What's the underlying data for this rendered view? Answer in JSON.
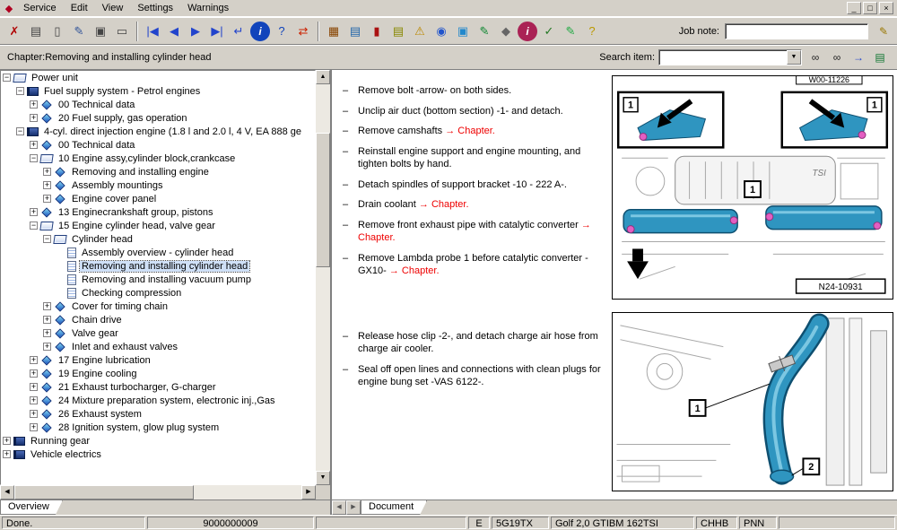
{
  "window": {
    "menu_items": [
      "Service",
      "Edit",
      "View",
      "Settings",
      "Warnings"
    ],
    "controls": {
      "minimize": "_",
      "restore": "□",
      "close": "×"
    }
  },
  "toolbar": {
    "job_note_label": "Job note:",
    "job_note_value": "",
    "icons": [
      {
        "name": "exit-icon",
        "glyph": "✗",
        "color": "#b00000"
      },
      {
        "name": "print-icon",
        "glyph": "▤",
        "color": "#444444"
      },
      {
        "name": "new-document-icon",
        "glyph": "▯",
        "color": "#444444"
      },
      {
        "name": "edit-document-icon",
        "glyph": "✎",
        "color": "#335599"
      },
      {
        "name": "documents-icon",
        "glyph": "▣",
        "color": "#444444"
      },
      {
        "name": "vehicle-data-icon",
        "glyph": "▭",
        "color": "#444444"
      },
      {
        "sep": true
      },
      {
        "name": "first-record-icon",
        "glyph": "|◀",
        "color": "#2244cc"
      },
      {
        "name": "previous-record-icon",
        "glyph": "◀",
        "color": "#2244cc"
      },
      {
        "name": "next-record-icon",
        "glyph": "▶",
        "color": "#2244cc"
      },
      {
        "name": "last-record-icon",
        "glyph": "▶|",
        "color": "#2244cc"
      },
      {
        "name": "return-icon",
        "glyph": "↵",
        "color": "#2244cc"
      },
      {
        "name": "info-icon",
        "glyph": "i",
        "color": "#ffffff",
        "bg": "#1144bb",
        "round": true
      },
      {
        "name": "help-icon",
        "glyph": "?",
        "color": "#1144bb"
      },
      {
        "name": "swap-icon",
        "glyph": "⇄",
        "color": "#cc2200"
      },
      {
        "sep": true
      },
      {
        "name": "cards-icon",
        "glyph": "▦",
        "color": "#884400"
      },
      {
        "name": "print-list-icon",
        "glyph": "▤",
        "color": "#2266aa"
      },
      {
        "name": "manual-icon",
        "glyph": "▮",
        "color": "#aa1111"
      },
      {
        "name": "notes-list-icon",
        "glyph": "▤",
        "color": "#888800"
      },
      {
        "name": "warning-icon",
        "glyph": "⚠",
        "color": "#bb8800"
      },
      {
        "name": "globe-icon",
        "glyph": "◉",
        "color": "#2255cc"
      },
      {
        "name": "monitor-icon",
        "glyph": "▣",
        "color": "#2288cc"
      },
      {
        "name": "edit-green-icon",
        "glyph": "✎",
        "color": "#118833"
      },
      {
        "name": "key-icon",
        "glyph": "◆",
        "color": "#666666"
      },
      {
        "name": "service-info-icon",
        "glyph": "i",
        "color": "#ffffff",
        "bg": "#aa2255",
        "round": true
      },
      {
        "name": "check-doc-icon",
        "glyph": "✓",
        "color": "#227722"
      },
      {
        "name": "write-icon",
        "glyph": "✎",
        "color": "#22aa44"
      },
      {
        "name": "query-icon",
        "glyph": "?",
        "color": "#bb9900"
      }
    ]
  },
  "chapter_bar": {
    "chapter_label": "Chapter:Removing and installing cylinder head",
    "search_label": "Search item:",
    "search_value": "",
    "icons": [
      {
        "name": "search-document-icon",
        "glyph": "∞",
        "color": "#222222"
      },
      {
        "name": "search-global-icon",
        "glyph": "∞",
        "color": "#222222"
      },
      {
        "name": "search-go-icon",
        "glyph": "→",
        "color": "#2244cc"
      },
      {
        "name": "search-list-icon",
        "glyph": "▤",
        "color": "#117733"
      }
    ]
  },
  "tree": {
    "items": [
      {
        "indent": 0,
        "toggle": "-",
        "icon": "book-open",
        "label": "Power unit"
      },
      {
        "indent": 1,
        "toggle": "-",
        "icon": "book",
        "label": "Fuel supply system - Petrol engines"
      },
      {
        "indent": 2,
        "toggle": "+",
        "icon": "diamond",
        "label": "00 Technical data"
      },
      {
        "indent": 2,
        "toggle": "+",
        "icon": "diamond",
        "label": "20 Fuel supply, gas operation"
      },
      {
        "indent": 1,
        "toggle": "-",
        "icon": "book",
        "label": "4-cyl. direct injection engine (1.8 l and 2.0 l, 4 V, EA 888 ge"
      },
      {
        "indent": 2,
        "toggle": "+",
        "icon": "diamond",
        "label": "00 Technical data"
      },
      {
        "indent": 2,
        "toggle": "-",
        "icon": "book-open",
        "label": "10 Engine assy,cylinder block,crankcase"
      },
      {
        "indent": 3,
        "toggle": "+",
        "icon": "diamond",
        "label": "Removing and installing engine"
      },
      {
        "indent": 3,
        "toggle": "+",
        "icon": "diamond",
        "label": "Assembly mountings"
      },
      {
        "indent": 3,
        "toggle": "+",
        "icon": "diamond",
        "label": "Engine cover panel"
      },
      {
        "indent": 2,
        "toggle": "+",
        "icon": "diamond",
        "label": "13 Enginecrankshaft group, pistons"
      },
      {
        "indent": 2,
        "toggle": "-",
        "icon": "book-open",
        "label": "15 Engine cylinder head, valve gear"
      },
      {
        "indent": 3,
        "toggle": "-",
        "icon": "book-open",
        "label": "Cylinder head"
      },
      {
        "indent": 4,
        "toggle": "",
        "icon": "doc",
        "label": "Assembly overview - cylinder head"
      },
      {
        "indent": 4,
        "toggle": "",
        "icon": "doc",
        "label": "Removing and installing cylinder head",
        "selected": true
      },
      {
        "indent": 4,
        "toggle": "",
        "icon": "doc",
        "label": "Removing and installing vacuum pump"
      },
      {
        "indent": 4,
        "toggle": "",
        "icon": "doc",
        "label": "Checking compression"
      },
      {
        "indent": 3,
        "toggle": "+",
        "icon": "diamond",
        "label": "Cover for timing chain"
      },
      {
        "indent": 3,
        "toggle": "+",
        "icon": "diamond",
        "label": "Chain drive"
      },
      {
        "indent": 3,
        "toggle": "+",
        "icon": "diamond",
        "label": "Valve gear"
      },
      {
        "indent": 3,
        "toggle": "+",
        "icon": "diamond",
        "label": "Inlet and exhaust valves"
      },
      {
        "indent": 2,
        "toggle": "+",
        "icon": "diamond",
        "label": "17 Engine lubrication"
      },
      {
        "indent": 2,
        "toggle": "+",
        "icon": "diamond",
        "label": "19 Engine cooling"
      },
      {
        "indent": 2,
        "toggle": "+",
        "icon": "diamond",
        "label": "21 Exhaust turbocharger, G-charger"
      },
      {
        "indent": 2,
        "toggle": "+",
        "icon": "diamond",
        "label": "24 Mixture preparation system, electronic inj.,Gas"
      },
      {
        "indent": 2,
        "toggle": "+",
        "icon": "diamond",
        "label": "26 Exhaust system"
      },
      {
        "indent": 2,
        "toggle": "+",
        "icon": "diamond",
        "label": "28 Ignition system, glow plug system"
      },
      {
        "indent": 0,
        "toggle": "+",
        "icon": "book",
        "label": "Running gear"
      },
      {
        "indent": 0,
        "toggle": "+",
        "icon": "book",
        "label": "Vehicle electrics"
      }
    ]
  },
  "document": {
    "paragraphs": [
      {
        "text": "Remove bolt -arrow- on both sides."
      },
      {
        "text": "Unclip air duct (bottom section) -1- and detach."
      },
      {
        "text": "Remove camshafts",
        "link": "→ Chapter."
      },
      {
        "text": "Reinstall engine support and engine mounting, and tighten bolts by hand."
      },
      {
        "text": "Detach spindles of support bracket -10 - 222 A-."
      },
      {
        "text": "Drain coolant",
        "link": "→ Chapter."
      },
      {
        "text": "Remove front exhaust pipe with catalytic converter",
        "link": "→ Chapter."
      },
      {
        "text": "Remove Lambda probe 1 before catalytic converter -GX10-",
        "link": "→ Chapter."
      },
      {
        "text": "Release hose clip -2-, and detach charge air hose from charge air cooler.",
        "gap": true
      },
      {
        "text": "Seal off open lines and connections with clean plugs for engine bung set -VAS 6122-."
      }
    ]
  },
  "tabs": {
    "overview": "Overview",
    "document": "Document"
  },
  "figures": {
    "top": {
      "top_ref": "W00-11226",
      "ref": "N24-10931",
      "engine_label": "TSI",
      "callout_left": "1",
      "callout_right": "1",
      "callout_main": "1"
    },
    "bottom": {
      "callout_clip": "1",
      "callout_hose": "2"
    }
  },
  "status": {
    "message": "Done.",
    "order_number": "9000000009",
    "fields": [
      "E",
      "5G19TX",
      "Golf 2,0 GTIBM 162TSI",
      "CHHB",
      "PNN"
    ]
  }
}
